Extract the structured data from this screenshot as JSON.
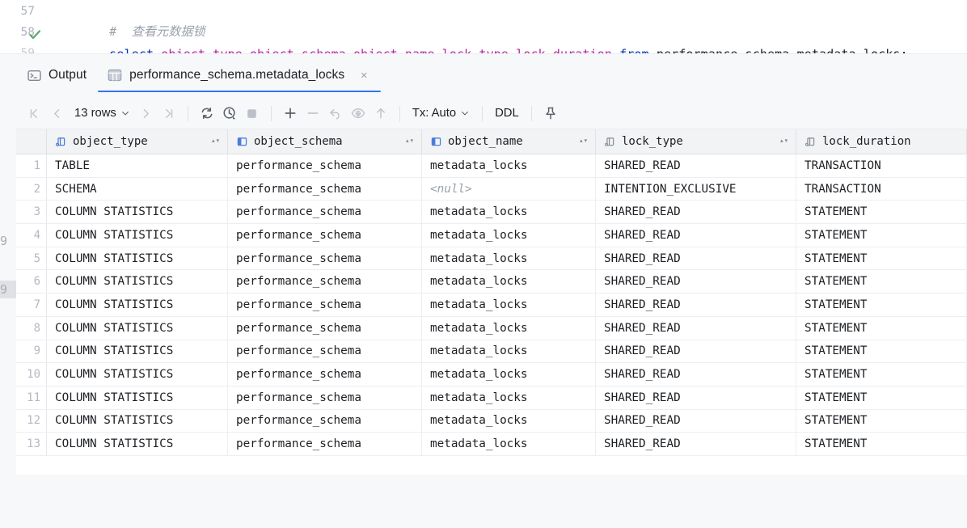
{
  "editor": {
    "lines": [
      {
        "number": "57",
        "tokens": [
          {
            "t": "comment",
            "text": "#  查看元数据锁"
          }
        ]
      },
      {
        "number": "58",
        "has_run_marker": true
      }
    ],
    "sql_parts": {
      "select_kw": "select",
      "columns": " object_type,object_schema,object_name,lock_type,lock_duration",
      "from_kw": " from ",
      "table": "performance_schema.metadata_locks;"
    },
    "comment_text": "#  查看元数据锁",
    "line_57": "57",
    "line_58": "58",
    "line_59_partial": "59",
    "gutter_left_bleed": [
      {
        "text": "9"
      },
      {
        "text": "9"
      }
    ]
  },
  "tabs": [
    {
      "label": "Output",
      "icon": "console-icon",
      "active": false,
      "closable": false
    },
    {
      "label": "performance_schema.metadata_locks",
      "icon": "table-grid-icon",
      "active": true,
      "closable": true,
      "close_glyph": "×"
    }
  ],
  "toolbar": {
    "first_page_icon": "first-page-icon",
    "prev_page_icon": "prev-page-icon",
    "rows_label": "13 rows",
    "next_page_icon": "next-page-icon",
    "last_page_icon": "last-page-icon",
    "reload_icon": "reload-icon",
    "history_icon": "history-clock-icon",
    "stop_icon": "stop-icon",
    "add_row_icon": "add-row-icon",
    "delete_row_icon": "delete-row-icon",
    "revert_icon": "revert-icon",
    "view_query_icon": "view-query-icon",
    "submit_icon": "submit-icon",
    "tx_label": "Tx: Auto",
    "ddl_label": "DDL",
    "pin_icon": "pin-icon"
  },
  "grid": {
    "sort_glyph": "▴▾",
    "columns": [
      {
        "name": "object_type",
        "icon": "column-key-icon",
        "icon_color": "#4a7ddb",
        "sortable": true
      },
      {
        "name": "object_schema",
        "icon": "column-split-icon",
        "icon_color": "#4a7ddb",
        "sortable": true
      },
      {
        "name": "object_name",
        "icon": "column-split-icon",
        "icon_color": "#4a7ddb",
        "sortable": true
      },
      {
        "name": "lock_type",
        "icon": "column-key-icon",
        "icon_color": "#8b919c",
        "sortable": true
      },
      {
        "name": "lock_duration",
        "icon": "column-key-icon",
        "icon_color": "#8b919c",
        "sortable": false
      }
    ],
    "rows": [
      {
        "n": "1",
        "object_type": "TABLE",
        "object_schema": "performance_schema",
        "object_name": "metadata_locks",
        "lock_type": "SHARED_READ",
        "lock_duration": "TRANSACTION"
      },
      {
        "n": "2",
        "object_type": "SCHEMA",
        "object_schema": "performance_schema",
        "object_name": "<null>",
        "lock_type": "INTENTION_EXCLUSIVE",
        "lock_duration": "TRANSACTION",
        "object_name_is_null": true
      },
      {
        "n": "3",
        "object_type": "COLUMN STATISTICS",
        "object_schema": "performance_schema",
        "object_name": "metadata_locks",
        "lock_type": "SHARED_READ",
        "lock_duration": "STATEMENT"
      },
      {
        "n": "4",
        "object_type": "COLUMN STATISTICS",
        "object_schema": "performance_schema",
        "object_name": "metadata_locks",
        "lock_type": "SHARED_READ",
        "lock_duration": "STATEMENT"
      },
      {
        "n": "5",
        "object_type": "COLUMN STATISTICS",
        "object_schema": "performance_schema",
        "object_name": "metadata_locks",
        "lock_type": "SHARED_READ",
        "lock_duration": "STATEMENT"
      },
      {
        "n": "6",
        "object_type": "COLUMN STATISTICS",
        "object_schema": "performance_schema",
        "object_name": "metadata_locks",
        "lock_type": "SHARED_READ",
        "lock_duration": "STATEMENT"
      },
      {
        "n": "7",
        "object_type": "COLUMN STATISTICS",
        "object_schema": "performance_schema",
        "object_name": "metadata_locks",
        "lock_type": "SHARED_READ",
        "lock_duration": "STATEMENT"
      },
      {
        "n": "8",
        "object_type": "COLUMN STATISTICS",
        "object_schema": "performance_schema",
        "object_name": "metadata_locks",
        "lock_type": "SHARED_READ",
        "lock_duration": "STATEMENT"
      },
      {
        "n": "9",
        "object_type": "COLUMN STATISTICS",
        "object_schema": "performance_schema",
        "object_name": "metadata_locks",
        "lock_type": "SHARED_READ",
        "lock_duration": "STATEMENT"
      },
      {
        "n": "10",
        "object_type": "COLUMN STATISTICS",
        "object_schema": "performance_schema",
        "object_name": "metadata_locks",
        "lock_type": "SHARED_READ",
        "lock_duration": "STATEMENT"
      },
      {
        "n": "11",
        "object_type": "COLUMN STATISTICS",
        "object_schema": "performance_schema",
        "object_name": "metadata_locks",
        "lock_type": "SHARED_READ",
        "lock_duration": "STATEMENT"
      },
      {
        "n": "12",
        "object_type": "COLUMN STATISTICS",
        "object_schema": "performance_schema",
        "object_name": "metadata_locks",
        "lock_type": "SHARED_READ",
        "lock_duration": "STATEMENT"
      },
      {
        "n": "13",
        "object_type": "COLUMN STATISTICS",
        "object_schema": "performance_schema",
        "object_name": "metadata_locks",
        "lock_type": "SHARED_READ",
        "lock_duration": "STATEMENT"
      }
    ]
  },
  "colors": {
    "accent": "#3574f0",
    "keyword": "#0033b3",
    "column_token": "#b5259e",
    "comment": "#9aa0ab",
    "panel_bg": "#f7f8fa",
    "header_bg": "#f2f3f5",
    "grid_line": "#eceef1",
    "success_check": "#59a869"
  }
}
